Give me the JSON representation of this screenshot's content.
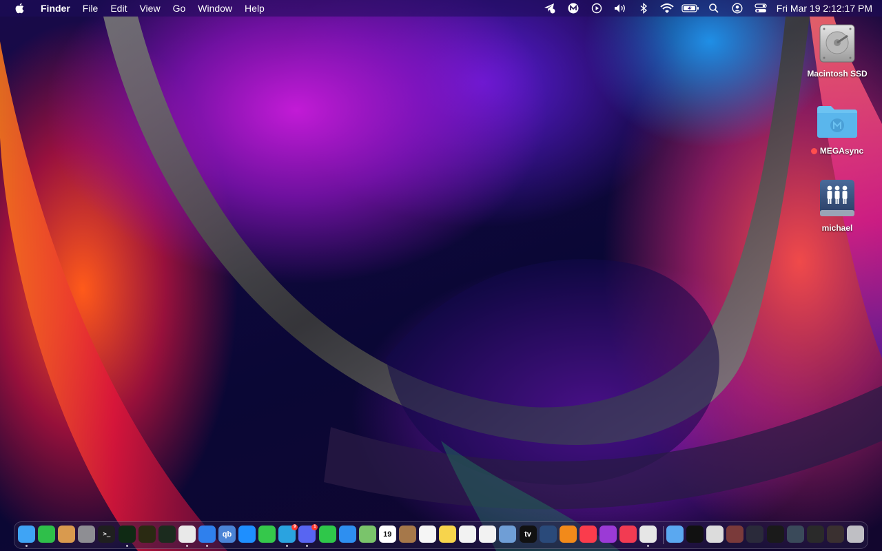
{
  "menubar": {
    "app_name": "Finder",
    "menus": [
      "File",
      "Edit",
      "View",
      "Go",
      "Window",
      "Help"
    ],
    "status_icons": [
      "telegram-status-icon",
      "mega-status-icon",
      "play-icon",
      "volume-icon",
      "bluetooth-icon",
      "wifi-icon",
      "battery-icon",
      "spotlight-search-icon",
      "user-icon",
      "control-center-icon"
    ],
    "clock": "Fri Mar 19  2:12:17 PM"
  },
  "desktop": {
    "icons": [
      {
        "label": "Macintosh SSD",
        "icon": "hard-drive-icon"
      },
      {
        "label": "MEGAsync",
        "icon": "mega-folder-icon",
        "tag_color": "#ff4e4e"
      },
      {
        "label": "michael",
        "icon": "network-share-icon"
      }
    ]
  },
  "dock": {
    "apps": [
      {
        "name": "Finder",
        "icon": "finder-icon",
        "color": "#3fa4f5",
        "running": true
      },
      {
        "name": "Evernote",
        "icon": "evernote-icon",
        "color": "#2fbf4a"
      },
      {
        "name": "Archive",
        "icon": "archive-icon",
        "color": "#d99a4e"
      },
      {
        "name": "System Preferences",
        "icon": "system-preferences-icon",
        "color": "#8e8e93"
      },
      {
        "name": "Terminal",
        "icon": "terminal-icon",
        "color": "#1f1f1f",
        "glyph": ">_"
      },
      {
        "name": "Terminal 2",
        "icon": "terminal-icon",
        "color": "#0f2a14",
        "running": true
      },
      {
        "name": "Warning",
        "icon": "console-icon",
        "color": "#2a2a12"
      },
      {
        "name": "Activity Monitor",
        "icon": "activity-monitor-icon",
        "color": "#1b2b1e"
      },
      {
        "name": "Chrome",
        "icon": "chrome-icon",
        "color": "#e9e9e9",
        "running": true
      },
      {
        "name": "Safari",
        "icon": "safari-icon",
        "color": "#2f80ed",
        "running": true
      },
      {
        "name": "qBittorrent",
        "icon": "qbittorrent-icon",
        "color": "#4a84d6",
        "glyph": "qb"
      },
      {
        "name": "App Store",
        "icon": "app-store-icon",
        "color": "#1e8fff"
      },
      {
        "name": "Messages",
        "icon": "messages-icon",
        "color": "#35c84b"
      },
      {
        "name": "Telegram",
        "icon": "telegram-icon",
        "color": "#2aa3e0",
        "running": true,
        "badge": "9"
      },
      {
        "name": "Discord",
        "icon": "discord-icon",
        "color": "#5865f2",
        "running": true,
        "badge": "1"
      },
      {
        "name": "FaceTime",
        "icon": "facetime-icon",
        "color": "#2fc74a"
      },
      {
        "name": "Mail",
        "icon": "mail-icon",
        "color": "#2e8ff0"
      },
      {
        "name": "Maps",
        "icon": "maps-icon",
        "color": "#7ac46b"
      },
      {
        "name": "Calendar",
        "icon": "calendar-icon",
        "color": "#ffffff",
        "glyph": "19"
      },
      {
        "name": "Contacts",
        "icon": "contacts-icon",
        "color": "#a6784a"
      },
      {
        "name": "Reminders",
        "icon": "reminders-icon",
        "color": "#f5f5f5"
      },
      {
        "name": "Notes",
        "icon": "notes-icon",
        "color": "#f7d44c"
      },
      {
        "name": "TextEdit",
        "icon": "textedit-icon",
        "color": "#f2f2f2"
      },
      {
        "name": "Photos",
        "icon": "photos-icon",
        "color": "#f2f2f2"
      },
      {
        "name": "Preview",
        "icon": "preview-icon",
        "color": "#6f9ed6"
      },
      {
        "name": "TV",
        "icon": "apple-tv-icon",
        "color": "#111111",
        "glyph": "tv"
      },
      {
        "name": "QuickTime",
        "icon": "quicktime-icon",
        "color": "#2a4a7a"
      },
      {
        "name": "VLC",
        "icon": "vlc-icon",
        "color": "#f28a1a"
      },
      {
        "name": "Music",
        "icon": "music-icon",
        "color": "#fa3c4c"
      },
      {
        "name": "Podcasts",
        "icon": "podcasts-icon",
        "color": "#9b3ad6"
      },
      {
        "name": "News",
        "icon": "news-icon",
        "color": "#f23b52"
      },
      {
        "name": "Script Editor",
        "icon": "script-editor-icon",
        "color": "#e6e6e6",
        "running": true
      }
    ],
    "others": [
      {
        "name": "Applications",
        "icon": "applications-folder-icon",
        "color": "#5aa8f0"
      },
      {
        "name": "Document",
        "icon": "document-icon",
        "color": "#111111"
      },
      {
        "name": "Window 1",
        "icon": "window-thumbnail-icon",
        "color": "#dcdcdc"
      },
      {
        "name": "Window 2",
        "icon": "window-thumbnail-icon",
        "color": "#7a3a3a"
      },
      {
        "name": "Window 3",
        "icon": "window-thumbnail-icon",
        "color": "#2a2a3a"
      },
      {
        "name": "Window 4",
        "icon": "window-thumbnail-icon",
        "color": "#1a1a1a"
      },
      {
        "name": "Window 5",
        "icon": "window-thumbnail-icon",
        "color": "#3a4a5a"
      },
      {
        "name": "Window 6",
        "icon": "window-thumbnail-icon",
        "color": "#2a2a2a"
      },
      {
        "name": "Window 7",
        "icon": "window-thumbnail-icon",
        "color": "#3a3030"
      },
      {
        "name": "Trash",
        "icon": "trash-icon",
        "color": "#bfbfc4"
      }
    ]
  }
}
